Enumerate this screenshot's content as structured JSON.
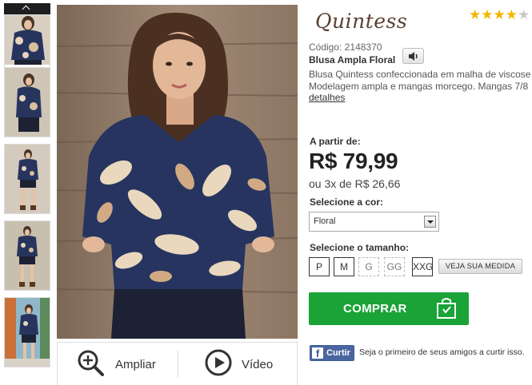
{
  "brand": {
    "name": "Quintess"
  },
  "rating": {
    "stars": 4,
    "max": 5
  },
  "product": {
    "code_label": "Código:",
    "code_value": "2148370",
    "name": "Blusa Ampla Floral",
    "desc_line1": "Blusa Quintess confeccionada em malha de viscose",
    "desc_line2": "Modelagem ampla e mangas morcego. Mangas 7/8",
    "details_link": "detalhes"
  },
  "pricing": {
    "from_label": "A partir de:",
    "price": "R$ 79,99",
    "installments": "ou 3x de R$ 26,66"
  },
  "color": {
    "label": "Selecione a cor:",
    "selected": "Floral"
  },
  "size": {
    "label": "Selecione o tamanho:",
    "options": [
      "P",
      "M",
      "G",
      "GG",
      "XXG"
    ],
    "measure_button": "VEJA SUA MEDIDA"
  },
  "buy_button": "COMPRAR",
  "facebook": {
    "button": "Curtir",
    "text": "Seja o primeiro de seus amigos a curtir isso."
  },
  "photo_bar": {
    "zoom": "Ampliar",
    "video": "Vídeo"
  },
  "icons": [
    "chevron-up-icon",
    "speaker-icon",
    "zoom-in-icon",
    "play-icon",
    "shopping-bag-icon",
    "facebook-icon",
    "star-icon"
  ],
  "colors": {
    "buy_green": "#1aa336",
    "brand_brown": "#5a4030",
    "facebook_blue": "#4a66a0",
    "star_gold": "#f2b600"
  }
}
